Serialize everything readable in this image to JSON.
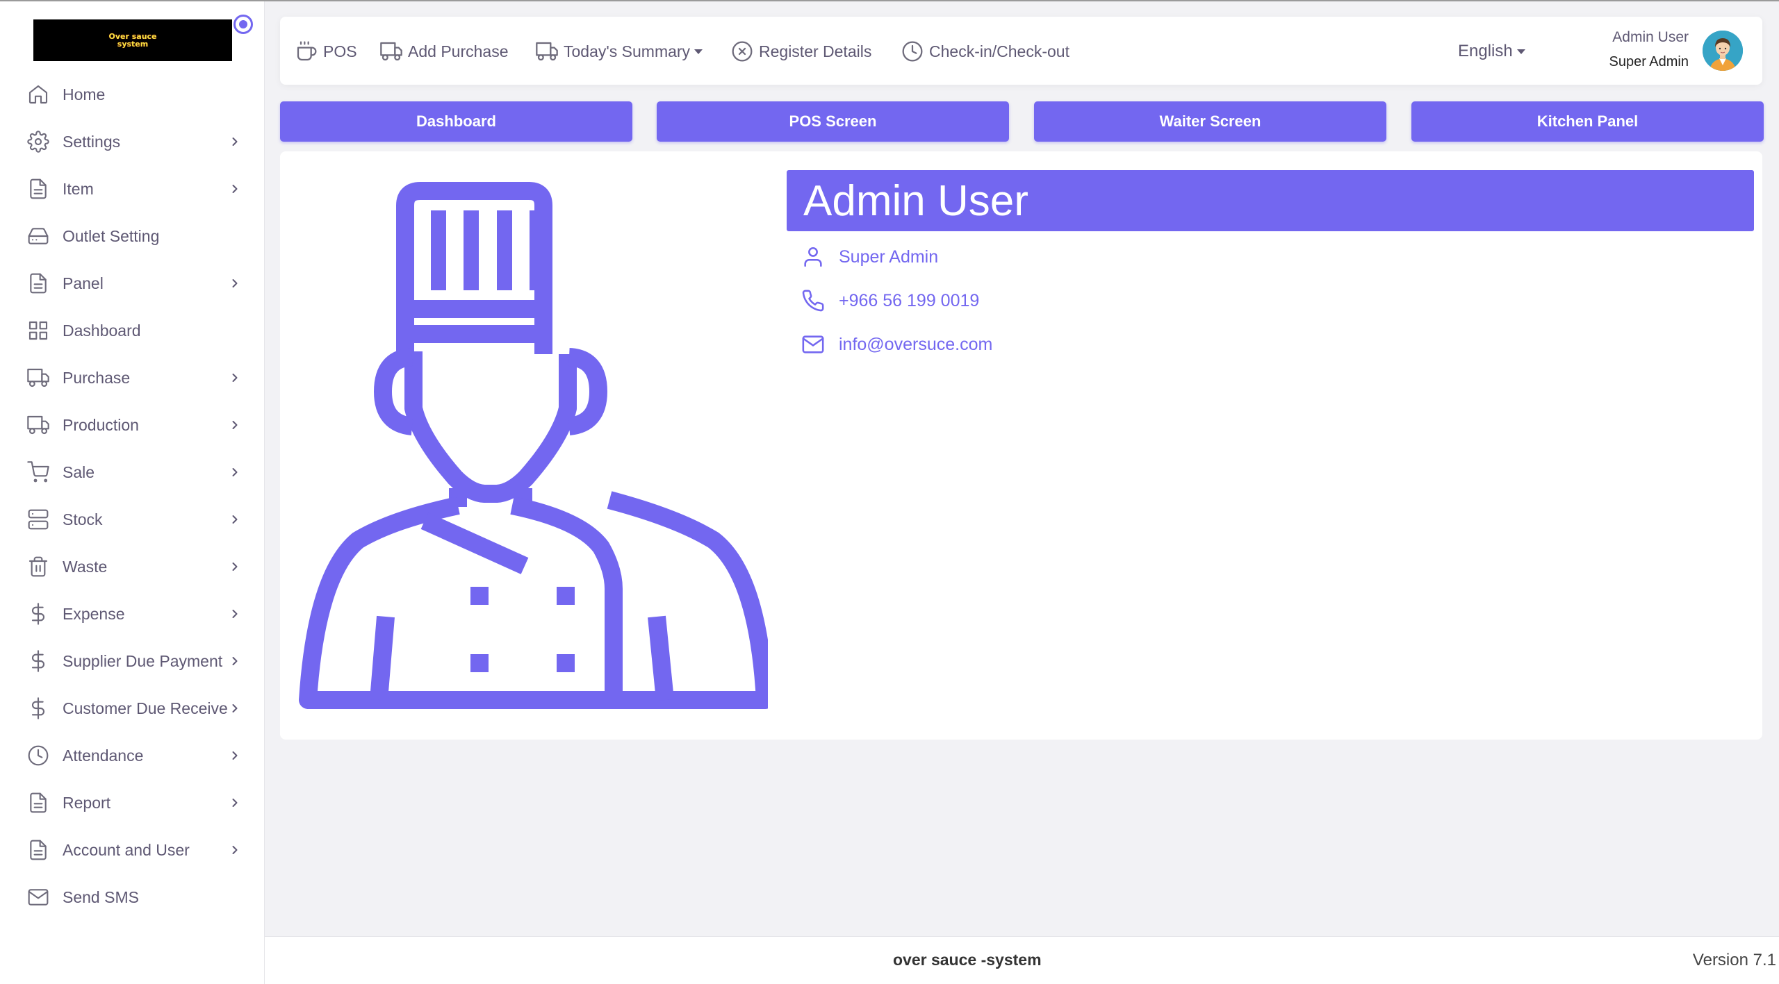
{
  "sidebar": {
    "logo_line1": "Over sauce",
    "logo_line2": "system",
    "items": [
      {
        "label": "Home",
        "icon": "home-icon",
        "has_submenu": false
      },
      {
        "label": "Settings",
        "icon": "gear-icon",
        "has_submenu": true
      },
      {
        "label": "Item",
        "icon": "file-icon",
        "has_submenu": true
      },
      {
        "label": "Outlet Setting",
        "icon": "hard-drive-icon",
        "has_submenu": false
      },
      {
        "label": "Panel",
        "icon": "file-icon",
        "has_submenu": true
      },
      {
        "label": "Dashboard",
        "icon": "grid-icon",
        "has_submenu": false
      },
      {
        "label": "Purchase",
        "icon": "truck-icon",
        "has_submenu": true
      },
      {
        "label": "Production",
        "icon": "truck-icon",
        "has_submenu": true
      },
      {
        "label": "Sale",
        "icon": "cart-icon",
        "has_submenu": true
      },
      {
        "label": "Stock",
        "icon": "server-icon",
        "has_submenu": true
      },
      {
        "label": "Waste",
        "icon": "trash-icon",
        "has_submenu": true
      },
      {
        "label": "Expense",
        "icon": "dollar-icon",
        "has_submenu": true
      },
      {
        "label": "Supplier Due Payment",
        "icon": "dollar-icon",
        "has_submenu": true
      },
      {
        "label": "Customer Due Receive",
        "icon": "dollar-icon",
        "has_submenu": true
      },
      {
        "label": "Attendance",
        "icon": "clock-icon",
        "has_submenu": true
      },
      {
        "label": "Report",
        "icon": "file-icon",
        "has_submenu": true
      },
      {
        "label": "Account and User",
        "icon": "file-icon",
        "has_submenu": true
      },
      {
        "label": "Send SMS",
        "icon": "mail-icon",
        "has_submenu": false
      }
    ]
  },
  "topbar": {
    "pos": "POS",
    "add_purchase": "Add Purchase",
    "todays_summary": "Today's Summary",
    "register_details": "Register Details",
    "check_in_out": "Check-in/Check-out",
    "language": "English",
    "user_name": "Admin User",
    "user_role": "Super Admin"
  },
  "quick_buttons": {
    "dashboard": "Dashboard",
    "pos_screen": "POS Screen",
    "waiter_screen": "Waiter Screen",
    "kitchen_panel": "Kitchen Panel"
  },
  "profile": {
    "name": "Admin User",
    "role": "Super Admin",
    "phone": "+966 56 199 0019",
    "email": "info@oversuce.com"
  },
  "footer": {
    "brand": "over sauce -system",
    "version": "Version 7.1"
  },
  "colors": {
    "accent": "#7367f0",
    "text": "#5e5873",
    "background": "#f2f2f5"
  }
}
